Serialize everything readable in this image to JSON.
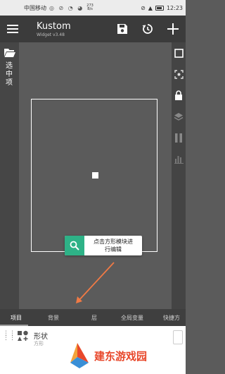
{
  "status_bar": {
    "carrier": "中国移动",
    "speed_value": "273",
    "speed_unit": "B/s",
    "time": "12:23"
  },
  "app_bar": {
    "title": "Kustom",
    "subtitle": "Widget v3.48"
  },
  "left_rail": {
    "vertical_label": "选中项"
  },
  "tooltip": {
    "line1": "点击方形模块进",
    "line2": "行编辑"
  },
  "tabs": [
    {
      "label": "项目"
    },
    {
      "label": "背景"
    },
    {
      "label": "层"
    },
    {
      "label": "全局变量"
    },
    {
      "label": "快捷方"
    }
  ],
  "item": {
    "name": "形状",
    "sub": "方形"
  },
  "watermark": {
    "text": "建东游戏园"
  },
  "colors": {
    "accent_green": "#2eb287",
    "annotation_orange": "#f07a45",
    "watermark_red": "#e8482b"
  }
}
